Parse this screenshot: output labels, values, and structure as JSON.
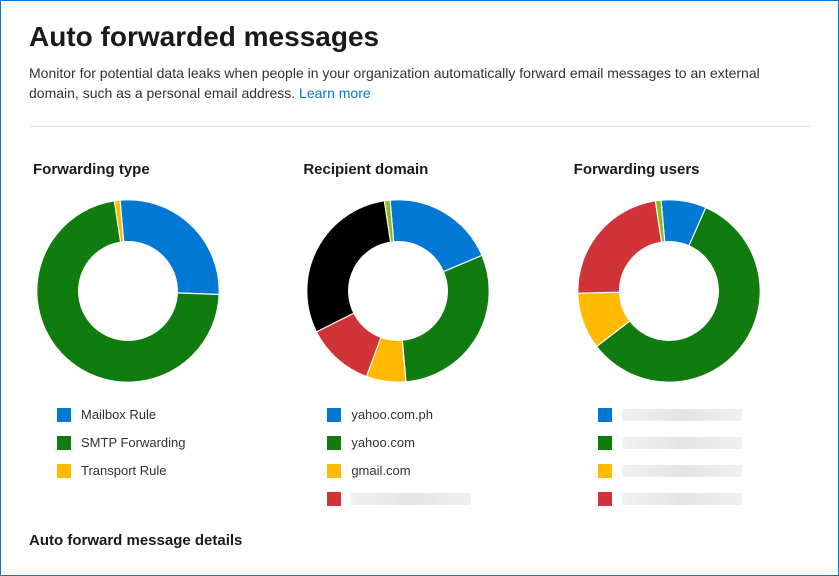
{
  "header": {
    "title": "Auto forwarded messages",
    "description": "Monitor for potential data leaks when people in your organization automatically forward email messages to an external domain, such as a personal email address.",
    "learn_more": "Learn more"
  },
  "details_heading": "Auto forward message details",
  "colors": {
    "blue": "#0078d4",
    "green": "#107c10",
    "yellow": "#ffb900",
    "red": "#d13438",
    "black": "#000000",
    "lightgreen": "#8cbd18"
  },
  "charts": [
    {
      "title": "Forwarding type",
      "segments": [
        {
          "label": "Mailbox Rule",
          "pct": 27,
          "color": "blue",
          "redacted": false
        },
        {
          "label": "SMTP Forwarding",
          "pct": 72,
          "color": "green",
          "redacted": false
        },
        {
          "label": "Transport Rule",
          "pct": 1,
          "color": "yellow",
          "redacted": false
        }
      ]
    },
    {
      "title": "Recipient domain",
      "segments": [
        {
          "label": "yahoo.com.ph",
          "pct": 20,
          "color": "blue",
          "redacted": false
        },
        {
          "label": "yahoo.com",
          "pct": 30,
          "color": "green",
          "redacted": false
        },
        {
          "label": "gmail.com",
          "pct": 7,
          "color": "yellow",
          "redacted": false
        },
        {
          "label": "",
          "pct": 12,
          "color": "red",
          "redacted": true
        },
        {
          "label": "",
          "pct": 30,
          "color": "black",
          "redacted": false,
          "hidden_legend": true
        },
        {
          "label": "",
          "pct": 1,
          "color": "lightgreen",
          "redacted": false,
          "hidden_legend": true
        }
      ]
    },
    {
      "title": "Forwarding users",
      "segments": [
        {
          "label": "",
          "pct": 8,
          "color": "blue",
          "redacted": true
        },
        {
          "label": "",
          "pct": 58,
          "color": "green",
          "redacted": true
        },
        {
          "label": "",
          "pct": 10,
          "color": "yellow",
          "redacted": true
        },
        {
          "label": "",
          "pct": 23,
          "color": "red",
          "redacted": true
        },
        {
          "label": "",
          "pct": 1,
          "color": "lightgreen",
          "redacted": false,
          "hidden_legend": true
        }
      ]
    }
  ],
  "chart_data": [
    {
      "type": "pie",
      "title": "Forwarding type",
      "categories": [
        "Mailbox Rule",
        "SMTP Forwarding",
        "Transport Rule"
      ],
      "values": [
        27,
        72,
        1
      ]
    },
    {
      "type": "pie",
      "title": "Recipient domain",
      "categories": [
        "yahoo.com.ph",
        "yahoo.com",
        "gmail.com",
        "(redacted)",
        "(other)",
        "(other)"
      ],
      "values": [
        20,
        30,
        7,
        12,
        30,
        1
      ]
    },
    {
      "type": "pie",
      "title": "Forwarding users",
      "categories": [
        "(redacted)",
        "(redacted)",
        "(redacted)",
        "(redacted)",
        "(other)"
      ],
      "values": [
        8,
        58,
        10,
        23,
        1
      ]
    }
  ]
}
